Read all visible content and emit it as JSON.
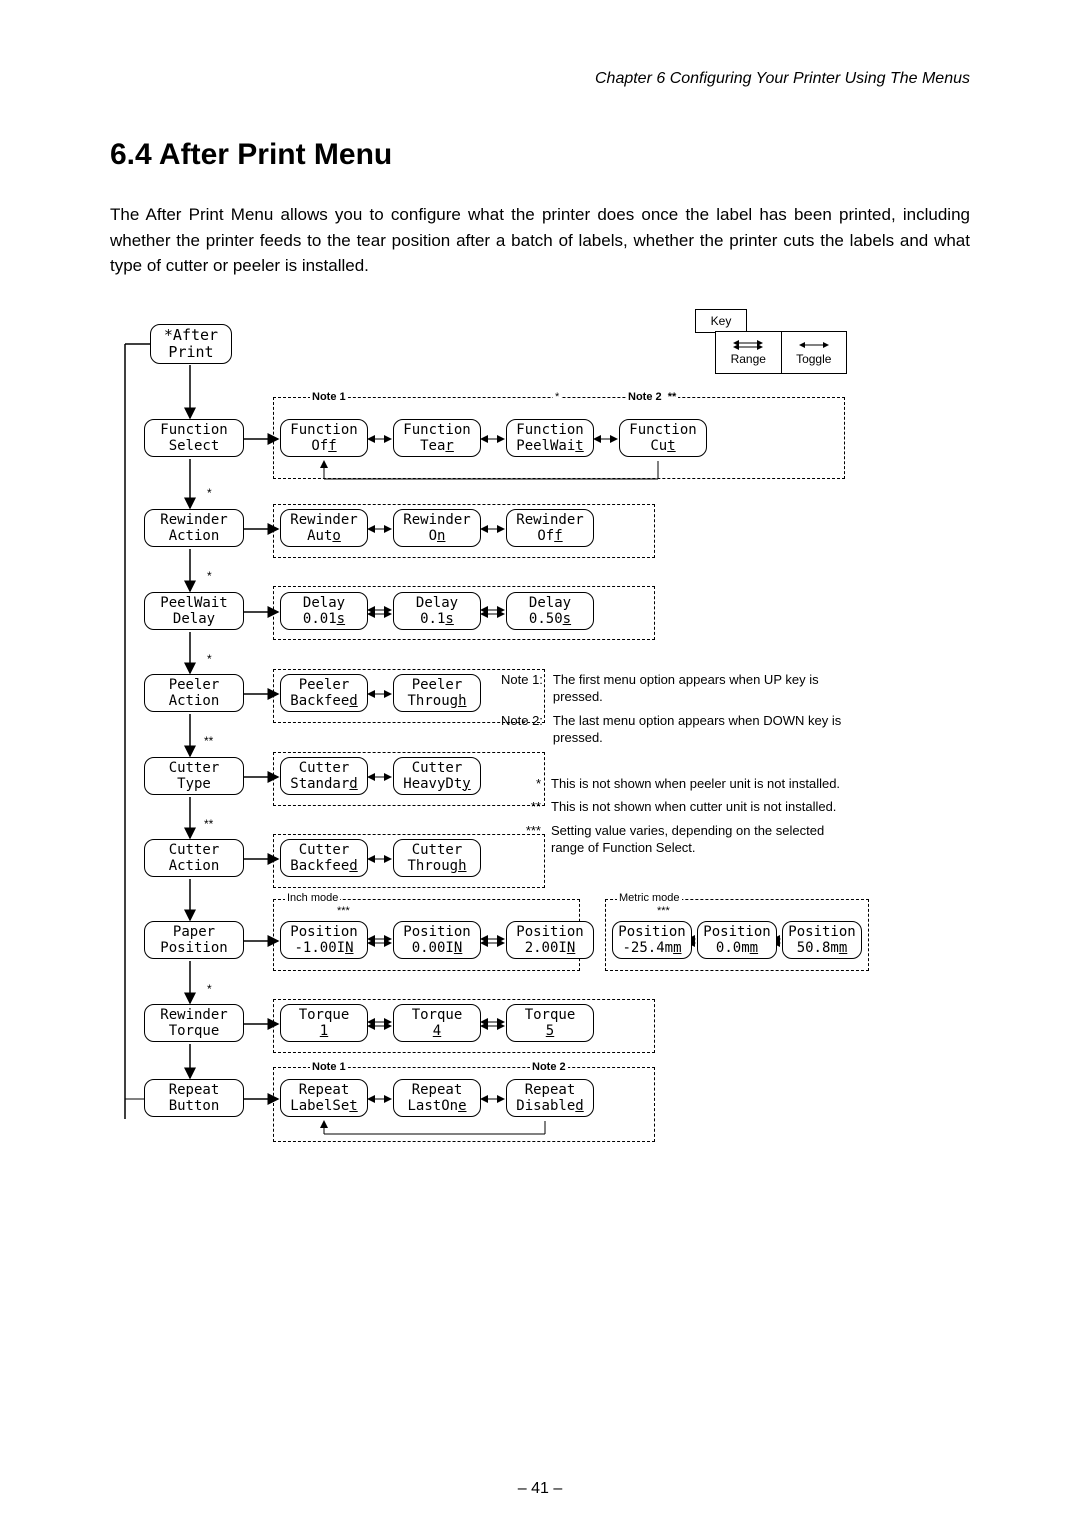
{
  "chapter_header": "Chapter 6   Configuring Your Printer Using The Menus",
  "section_title": "6.4   After Print Menu",
  "body_paragraph": "The After Print Menu allows you to configure what the printer does once the label has been printed, including whether the printer feeds to the tear position after a batch of labels, whether the printer cuts the labels and what type of cutter or peeler is installed.",
  "key": {
    "title": "Key",
    "range": "Range",
    "toggle": "Toggle"
  },
  "diagram": {
    "root": {
      "line1": "*After",
      "line2": "Print"
    },
    "rows": [
      {
        "menu_line1": "Function",
        "menu_line2": "Select",
        "opts": [
          {
            "l1": "Function",
            "l2": "Off"
          },
          {
            "l1": "Function",
            "l2": "Tear"
          },
          {
            "l1": "Function",
            "l2": "PeelWait"
          },
          {
            "l1": "Function",
            "l2": "Cut"
          }
        ]
      },
      {
        "menu_line1": "Rewinder",
        "menu_line2": "Action",
        "opts": [
          {
            "l1": "Rewinder",
            "l2": "Auto"
          },
          {
            "l1": "Rewinder",
            "l2": "On"
          },
          {
            "l1": "Rewinder",
            "l2": "Off"
          }
        ]
      },
      {
        "menu_line1": "PeelWait",
        "menu_line2": "Delay",
        "opts": [
          {
            "l1": "Delay",
            "l2": "0.01s"
          },
          {
            "l1": "Delay",
            "l2": "0.1s"
          },
          {
            "l1": "Delay",
            "l2": "0.50s"
          }
        ]
      },
      {
        "menu_line1": "Peeler",
        "menu_line2": "Action",
        "opts": [
          {
            "l1": "Peeler",
            "l2": "Backfeed"
          },
          {
            "l1": "Peeler",
            "l2": "Through"
          }
        ]
      },
      {
        "menu_line1": "Cutter",
        "menu_line2": "Type",
        "opts": [
          {
            "l1": "Cutter",
            "l2": "Standard"
          },
          {
            "l1": "Cutter",
            "l2": "HeavyDty"
          }
        ]
      },
      {
        "menu_line1": "Cutter",
        "menu_line2": "Action",
        "opts": [
          {
            "l1": "Cutter",
            "l2": "Backfeed"
          },
          {
            "l1": "Cutter",
            "l2": "Through"
          }
        ]
      },
      {
        "menu_line1": "Paper",
        "menu_line2": "Position",
        "opts": [
          {
            "l1": "Position",
            "l2": "-1.00IN"
          },
          {
            "l1": "Position",
            "l2": "0.00IN"
          },
          {
            "l1": "Position",
            "l2": "2.00IN"
          }
        ],
        "metric": [
          {
            "l1": "Position",
            "l2": "-25.4mm"
          },
          {
            "l1": "Position",
            "l2": "0.0mm"
          },
          {
            "l1": "Position",
            "l2": "50.8mm"
          }
        ]
      },
      {
        "menu_line1": "Rewinder",
        "menu_line2": "Torque",
        "opts": [
          {
            "l1": "Torque",
            "l2": "1"
          },
          {
            "l1": "Torque",
            "l2": "4"
          },
          {
            "l1": "Torque",
            "l2": "5"
          }
        ]
      },
      {
        "menu_line1": "Repeat",
        "menu_line2": "Button",
        "opts": [
          {
            "l1": "Repeat",
            "l2": "LabelSet"
          },
          {
            "l1": "Repeat",
            "l2": "LastOne"
          },
          {
            "l1": "Repeat",
            "l2": "Disabled"
          }
        ]
      }
    ],
    "labels": {
      "note1": "Note 1",
      "note2": "Note 2",
      "inch_mode": "Inch mode",
      "metric_mode": "Metric mode",
      "star": "*",
      "star2": "**",
      "star3": "***"
    }
  },
  "notes": {
    "n1_label": "Note 1:",
    "n1_text": "The first menu option appears when UP key is pressed.",
    "n2_label": "Note 2:",
    "n2_text": "The last menu option appears when DOWN key is pressed.",
    "s1_label": "*",
    "s1_text": "This is not shown when peeler unit is not installed.",
    "s2_label": "**",
    "s2_text": "This is not shown when cutter unit is not installed.",
    "s3_label": "***",
    "s3_text": "Setting value varies, depending on the selected range of Function Select."
  },
  "page_number": "– 41 –"
}
